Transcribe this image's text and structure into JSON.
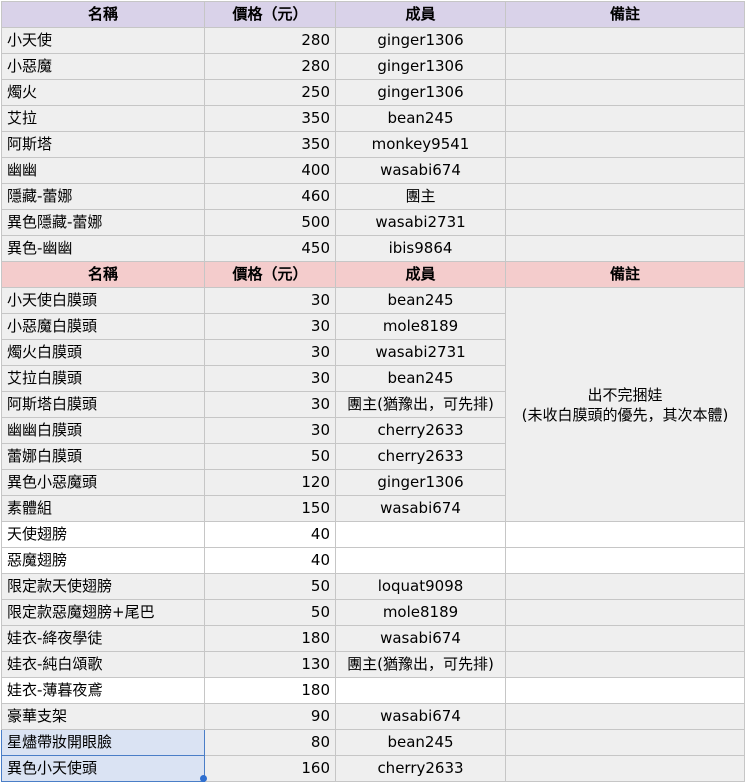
{
  "table1": {
    "headers": [
      "名稱",
      "價格（元）",
      "成員",
      "備註"
    ],
    "rows": [
      {
        "name": "小天使",
        "price": "280",
        "member": "ginger1306",
        "note": ""
      },
      {
        "name": "小惡魔",
        "price": "280",
        "member": "ginger1306",
        "note": ""
      },
      {
        "name": "燭火",
        "price": "250",
        "member": "ginger1306",
        "note": ""
      },
      {
        "name": "艾拉",
        "price": "350",
        "member": "bean245",
        "note": ""
      },
      {
        "name": "阿斯塔",
        "price": "350",
        "member": "monkey9541",
        "note": ""
      },
      {
        "name": "幽幽",
        "price": "400",
        "member": "wasabi674",
        "note": ""
      },
      {
        "name": "隱藏-蕾娜",
        "price": "460",
        "member": "團主",
        "note": ""
      },
      {
        "name": "異色隱藏-蕾娜",
        "price": "500",
        "member": "wasabi2731",
        "note": ""
      },
      {
        "name": "異色-幽幽",
        "price": "450",
        "member": "ibis9864",
        "note": ""
      }
    ]
  },
  "table2": {
    "headers": [
      "名稱",
      "價格（元）",
      "成員",
      "備註"
    ],
    "merged_note": {
      "line1": "出不完捆娃",
      "line2": "(未收白膜頭的優先，其次本體)"
    },
    "rows": [
      {
        "name": "小天使白膜頭",
        "price": "30",
        "member": "bean245",
        "bg": "gray"
      },
      {
        "name": "小惡魔白膜頭",
        "price": "30",
        "member": "mole8189",
        "bg": "gray"
      },
      {
        "name": "燭火白膜頭",
        "price": "30",
        "member": "wasabi2731",
        "bg": "gray"
      },
      {
        "name": "艾拉白膜頭",
        "price": "30",
        "member": "bean245",
        "bg": "gray"
      },
      {
        "name": "阿斯塔白膜頭",
        "price": "30",
        "member": "團主(猶豫出，可先排)",
        "bg": "gray"
      },
      {
        "name": "幽幽白膜頭",
        "price": "30",
        "member": "cherry2633",
        "bg": "gray"
      },
      {
        "name": "蕾娜白膜頭",
        "price": "50",
        "member": "cherry2633",
        "bg": "gray"
      },
      {
        "name": "異色小惡魔頭",
        "price": "120",
        "member": "ginger1306",
        "bg": "gray"
      },
      {
        "name": "素體組",
        "price": "150",
        "member": "wasabi674",
        "bg": "gray"
      },
      {
        "name": "天使翅膀",
        "price": "40",
        "member": "",
        "bg": "white"
      },
      {
        "name": "惡魔翅膀",
        "price": "40",
        "member": "",
        "bg": "white"
      },
      {
        "name": "限定款天使翅膀",
        "price": "50",
        "member": "loquat9098",
        "bg": "gray"
      },
      {
        "name": "限定款惡魔翅膀+尾巴",
        "price": "50",
        "member": "mole8189",
        "bg": "gray"
      },
      {
        "name": "娃衣-絳夜學徒",
        "price": "180",
        "member": "wasabi674",
        "bg": "gray"
      },
      {
        "name": "娃衣-純白頌歌",
        "price": "130",
        "member": "團主(猶豫出，可先排)",
        "bg": "gray"
      },
      {
        "name": "娃衣-薄暮夜鳶",
        "price": "180",
        "member": "",
        "bg": "white"
      },
      {
        "name": "豪華支架",
        "price": "90",
        "member": "wasabi674",
        "bg": "gray"
      },
      {
        "name": "星燼帶妝開眼臉",
        "price": "80",
        "member": "bean245",
        "bg": "gray",
        "selected": true
      },
      {
        "name": "異色小天使頭",
        "price": "160",
        "member": "cherry2633",
        "bg": "gray",
        "selected": true
      }
    ]
  }
}
